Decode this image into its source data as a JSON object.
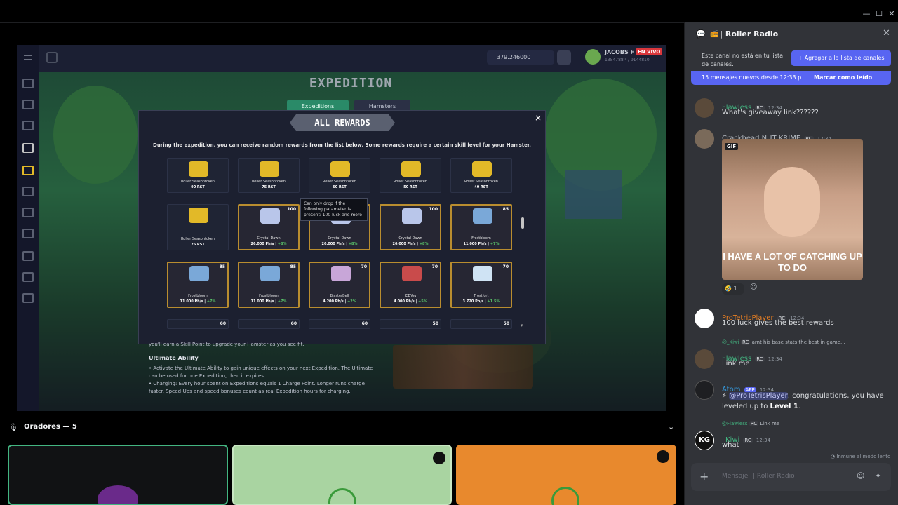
{
  "stream": {
    "player_balance": "379.246000",
    "player_name": "JACOBS F",
    "player_stats": "1354788 ᵒ / 9144810",
    "live_badge": "EN VIVO",
    "title": "EXPEDITION",
    "tabs": [
      "Expeditions",
      "Hamsters"
    ],
    "modal": {
      "title": "ALL REWARDS",
      "close": "×",
      "description": "During the expedition, you can receive random rewards from the list below. Some rewards require a certain skill level for your Hamster.",
      "tooltip": "Can only drop if the following parameter is present: 100 luck and more",
      "rows": [
        [
          {
            "name": "Roller Seasontoken",
            "value": "90 RST",
            "badge": "",
            "gold": false,
            "art": "#e2b928"
          },
          {
            "name": "Roller Seasontoken",
            "value": "75 RST",
            "badge": "",
            "gold": false,
            "art": "#e2b928"
          },
          {
            "name": "Roller Seasontoken",
            "value": "60 RST",
            "badge": "",
            "gold": false,
            "art": "#e2b928"
          },
          {
            "name": "Roller Seasontoken",
            "value": "50 RST",
            "badge": "",
            "gold": false,
            "art": "#e2b928"
          },
          {
            "name": "Roller Seasontoken",
            "value": "40 RST",
            "badge": "",
            "gold": false,
            "art": "#e2b928"
          }
        ],
        [
          {
            "name": "Roller Seasontoken",
            "value": "25 RST",
            "badge": "",
            "gold": false,
            "art": "#e2b928"
          },
          {
            "name": "Crystal Dawn",
            "value": "26.000 Ph/s",
            "boost": "+8%",
            "badge": "100",
            "gold": true,
            "art": "#b9c6ea"
          },
          {
            "name": "Crystal Dawn",
            "value": "26.000 Ph/s",
            "boost": "+8%",
            "badge": "100",
            "gold": true,
            "art": "#b9c6ea"
          },
          {
            "name": "Crystal Dawn",
            "value": "26.000 Ph/s",
            "boost": "+8%",
            "badge": "100",
            "gold": true,
            "art": "#b9c6ea"
          },
          {
            "name": "Frostbloom",
            "value": "11.000 Ph/s",
            "boost": "+7%",
            "badge": "85",
            "gold": true,
            "art": "#7aa8d8"
          }
        ],
        [
          {
            "name": "Frostbloom",
            "value": "11.000 Ph/s",
            "boost": "+7%",
            "badge": "85",
            "gold": true,
            "art": "#7aa8d8"
          },
          {
            "name": "Frostbloom",
            "value": "11.000 Ph/s",
            "boost": "+7%",
            "badge": "85",
            "gold": true,
            "art": "#7aa8d8"
          },
          {
            "name": "BlasterBell",
            "value": "4.200 Ph/s",
            "boost": "+2%",
            "badge": "70",
            "gold": true,
            "art": "#c8a6d8"
          },
          {
            "name": "ICEYou",
            "value": "4.000 Ph/s",
            "boost": "+5%",
            "badge": "70",
            "gold": true,
            "art": "#c94b4b"
          },
          {
            "name": "Frostfort",
            "value": "3.720 Ph/s",
            "boost": "+1.5%",
            "badge": "70",
            "gold": true,
            "art": "#cfe3f4"
          }
        ],
        [
          {
            "badge": "60"
          },
          {
            "badge": "60"
          },
          {
            "badge": "60"
          },
          {
            "badge": "50"
          },
          {
            "badge": "50"
          }
        ]
      ]
    },
    "below": {
      "line0": "you'll earn a Skill Point to upgrade your Hamster as you see fit.",
      "heading": "Ultimate Ability",
      "b1": "• Activate the Ultimate Ability to gain unique effects on your next Expedition. The Ultimate can be used for one Expedition, then it expires.",
      "b2": "• Charging: Every hour spent on Expeditions equals 1 Charge Point. Longer runs charge faster. Speed-Ups and speed bonuses count as real Expedition hours for charging."
    }
  },
  "speakers": {
    "label": "Oradores — 5",
    "cards": [
      {
        "bg": "#111214",
        "border": "#43b581"
      },
      {
        "bg": "#a9d4a1",
        "border": "#a9d4a1"
      },
      {
        "bg": "#e8892d",
        "border": "#e8892d"
      }
    ]
  },
  "chat": {
    "channel": "| Roller Radio",
    "not_in_list": "Este canal no está en tu lista de canales.",
    "add_button": "Agregar a la lista de canales",
    "new_messages": "15 mensajes nuevos desde 12:33 p....",
    "mark_read": "Marcar como leído",
    "gif_label": "GIF",
    "gif_caption": "I HAVE A LOT OF CATCHING UP TO DO",
    "reaction_count": "1",
    "messages": [
      {
        "author": "Flawless",
        "tag": "RC",
        "time": "12:34",
        "text": "What's giveaway link??????",
        "color": "#43b581"
      },
      {
        "author": "Crackhead NUT KRIME",
        "tag": "RC",
        "time": "12:34",
        "text": "",
        "color": "#b5bac1"
      },
      {
        "author": "ProTetrisPlayer",
        "tag": "RC",
        "time": "12:34",
        "text": "100 luck gives the best rewards",
        "color": "#e67e22"
      },
      {
        "author": "Flawless",
        "tag": "RC",
        "time": "12:34",
        "text": "Link me",
        "color": "#43b581",
        "reply": "@_Kiwi",
        "reply_tag": "RC",
        "reply_text": "arnt his base stats the best in game..."
      },
      {
        "author": "Atom",
        "tag": "APP",
        "time": "12:34",
        "mention": "@ProTetrisPlayer",
        "text_pre": "⚡ ",
        "text_post": ", congratulations, you have leveled up to ",
        "level": "Level 1",
        "text_end": ".",
        "color": "#3498db"
      },
      {
        "author": "_Kiwi",
        "tag": "RC",
        "time": "12:34",
        "text": "what",
        "color": "#43b581",
        "reply": "@Flawless",
        "reply_tag": "RC",
        "reply_text": "Link me"
      }
    ],
    "slowmode": "Inmune al modo lento",
    "composer_placeholder": "Mensaje",
    "composer_channel": "| Roller Radio"
  },
  "colors": {
    "accent": "#5865f2",
    "gold": "#b98d2f",
    "live": "#da373c"
  }
}
